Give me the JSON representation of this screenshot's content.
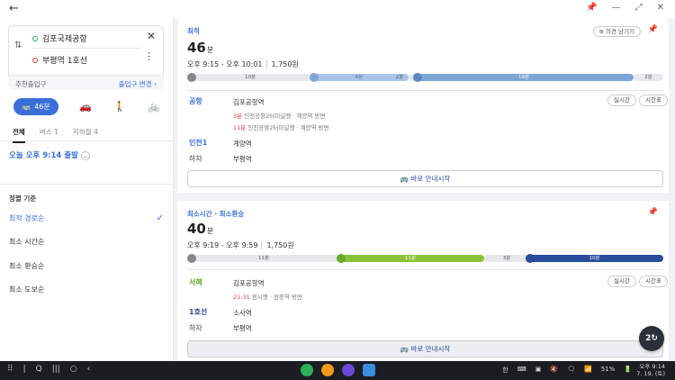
{
  "topbar": {
    "back": "←",
    "tools": [
      "📌",
      "—",
      "⤢",
      "✕"
    ]
  },
  "search": {
    "origin": "김포국제공항",
    "destination": "부평역 1호선",
    "swap": "⇅",
    "close": "✕",
    "more": "⋮",
    "recommend_exit": "추천출입구",
    "change_exit": "출입구 변경 ›"
  },
  "modes": {
    "bus_label": "46분",
    "bus_icon": "🚌",
    "car_icon": "🚗",
    "walk_icon": "🚶",
    "bike_icon": "🚲"
  },
  "tabs": [
    {
      "label": "전체"
    },
    {
      "label": "버스 1"
    },
    {
      "label": "지하철 4"
    }
  ],
  "depart": {
    "label": "오늘 오후 9:14 출발",
    "chev": "⌄"
  },
  "sort": {
    "title": "정렬 기준",
    "items": [
      "최적 경로순",
      "최소 시간순",
      "최소 환승순",
      "최소 도보순"
    ],
    "check": "✓"
  },
  "routes": [
    {
      "tag": "최적",
      "feedback": "⊕ 의견 남기기",
      "pin": "📌",
      "duration": "46",
      "duration_unit": "분",
      "time_range": "오후 9:15 - 오후 10:01",
      "fare": "1,750원",
      "segments": [
        "10분",
        "6분",
        "2분",
        "19분",
        "2분"
      ],
      "steps": [
        {
          "label": "공항",
          "stop": "김포공항역",
          "sub1_min": "3분",
          "sub1": "인천공항2터미널행 · 계양역 방면",
          "sub2_min": "11분",
          "sub2": "인천공항2터미널행 · 계양역 방면",
          "chip1": "실시간",
          "chip2": "시간표"
        },
        {
          "label": "인천1",
          "stop": "계양역"
        },
        {
          "label": "하차",
          "stop": "부평역"
        }
      ],
      "guide": "🚌 바로 안내시작"
    },
    {
      "tag": "최소시간 · 최소환승",
      "pin": "📌",
      "duration": "40",
      "duration_unit": "분",
      "time_range": "오후 9:19 - 오후 9:59",
      "fare": "1,750원",
      "segments": [
        "11분",
        "11분",
        "3분",
        "10분"
      ],
      "steps": [
        {
          "label": "서해",
          "stop": "김포공항역",
          "sub1_min": "21:31",
          "sub1": "원시행 · 원종역 방면",
          "chip1": "실시간",
          "chip2": "시간표"
        },
        {
          "label": "1호선",
          "stop": "소사역"
        },
        {
          "label": "하차",
          "stop": "부평역"
        }
      ],
      "guide": "🚌 바로 안내시작"
    }
  ],
  "fab": {
    "label": "2↻"
  },
  "taskbar": {
    "left_icons": [
      "⠿",
      "|",
      "Q",
      "|||",
      "○",
      "‹"
    ],
    "status": [
      "한",
      "⌨",
      "▣",
      "🔇",
      "🗨",
      "📶",
      "51%",
      "🔋"
    ],
    "time": "오후 9:14",
    "date": "7. 19. (토)"
  },
  "colors": {
    "accent": "#3a6fd8",
    "route1_line": "#7fa6d8",
    "route2_green": "#8ac23a",
    "route2_navy": "#2a4c9c",
    "alert": "#e23d3d"
  }
}
